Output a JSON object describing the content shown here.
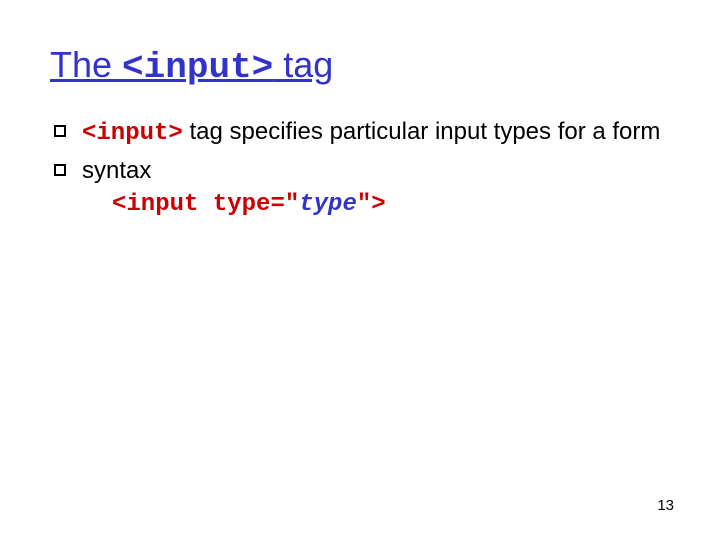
{
  "title": {
    "pre": "The ",
    "code": "<input>",
    "post": " tag"
  },
  "bullets": [
    {
      "code": "<input>",
      "rest": " tag specifies particular input types for a form"
    },
    {
      "text": "syntax"
    }
  ],
  "codeblock": {
    "open": "<",
    "tag": "input",
    "space": " ",
    "attr": "type=",
    "q1": "\"",
    "val": "type",
    "q2": "\"",
    "close": ">"
  },
  "pageNumber": "13"
}
